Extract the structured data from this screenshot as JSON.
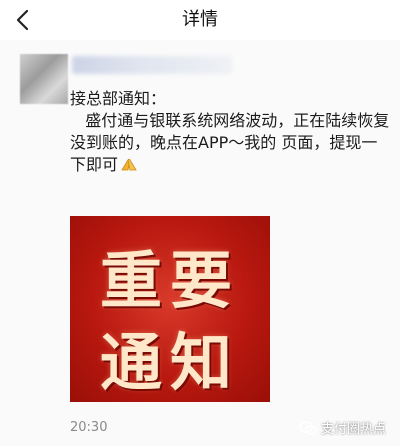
{
  "header": {
    "title": "详情",
    "back_icon": "chevron-left-icon"
  },
  "post": {
    "avatar_icon": "blurred-avatar",
    "author_name_blurred": true,
    "lines": [
      "接总部通知：",
      "   盛付通与银联系统网络波动，正在陆续恢复",
      "没到账的，晚点在APP～我的 页面，提现一下即可"
    ],
    "emoji_icon": "praying-hands-icon",
    "poster": {
      "line1": "重要",
      "line2": "通知",
      "background_color": "#b8180f",
      "text_color": "#ffe7c9"
    },
    "time": "20:30"
  },
  "watermark": {
    "icon": "wechat-icon",
    "text": "支付圈热点"
  }
}
